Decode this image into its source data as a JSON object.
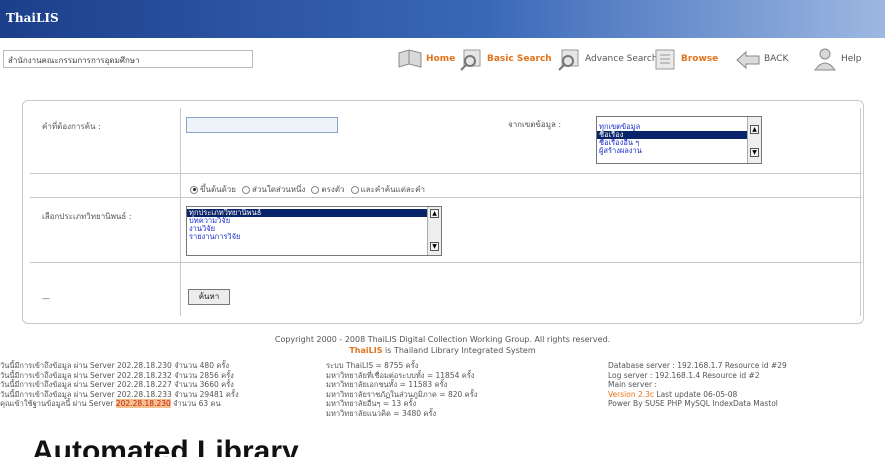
{
  "app": {
    "title": "ThaiLIS"
  },
  "nav": {
    "institution_value": "สำนักงานคณะกรรมการการอุดมศึกษา",
    "items": [
      {
        "label": "Home",
        "icon": "home-book-icon"
      },
      {
        "label": "Basic Search",
        "icon": "magnifier-icon"
      },
      {
        "label": "Advance Search",
        "icon": "magnifier-icon"
      },
      {
        "label": "Browse",
        "icon": "folder-icon"
      },
      {
        "label": "BACK",
        "icon": "back-arrow-icon"
      },
      {
        "label": "Help",
        "icon": "user-help-icon"
      }
    ]
  },
  "form": {
    "keyword_label": "คำที่ต้องการค้น :",
    "keyword_value": "",
    "field_label": "จากเขตข้อมูล :",
    "field_options": [
      "ทุกเขตข้อมูล",
      "ชื่อเรื่อง",
      "ชื่อเรื่องอื่น ๆ",
      "ผู้สร้างผลงาน"
    ],
    "field_selected": "ชื่อเรื่อง",
    "match_options": [
      {
        "label": "ขึ้นต้นด้วย",
        "checked": true
      },
      {
        "label": "ส่วนใดส่วนหนึ่ง",
        "checked": false
      },
      {
        "label": "ตรงตัว",
        "checked": false
      },
      {
        "label": "และคำค้นแต่ละคำ",
        "checked": false
      }
    ],
    "category_label": "เลือกประเภทวิทยานิพนธ์ :",
    "category_options": [
      "ทุกประเภทวิทยานิพนธ์",
      "บทความวิจัย",
      "งานวิจัย",
      "รายงานการวิจัย"
    ],
    "category_selected": "ทุกประเภทวิทยานิพนธ์",
    "bottom_label": "—",
    "search_button": "ค้นหา"
  },
  "footer": {
    "copyright": "Copyright 2000 - 2008 ThaiLIS Digital Collection Working Group. All rights reserved.",
    "tagline_brand": "ThaiLIS",
    "tagline_rest": "is Thailand Library Integrated System",
    "stats_left": [
      "วันนี้มีการเข้าถึงข้อมูล ผ่าน Server 202.28.18.230 จำนวน 480 ครั้ง",
      "วันนี้มีการเข้าถึงข้อมูล ผ่าน Server 202.28.18.232 จำนวน 2856 ครั้ง",
      "วันนี้มีการเข้าถึงข้อมูล ผ่าน Server 202.28.18.227 จำนวน 3660 ครั้ง",
      "วันนี้มีการเข้าถึงข้อมูล ผ่าน Server 202.28.18.233 จำนวน 29481 ครั้ง"
    ],
    "stats_left_last_prefix": "คุณเข้าใช้ฐานข้อมูลนี้ ผ่าน Server",
    "stats_left_last_ip": "202.28.18.230",
    "stats_left_last_suffix": "จำนวน 63 คน",
    "stats_mid": [
      "ระบบ ThaiLIS = 8755 ครั้ง",
      "มหาวิทยาลัยที่เชื่อมต่อระบบทั้ง = 11854 ครั้ง",
      "มหาวิทยาลัยเอกชนทั้ง = 11583 ครั้ง",
      "มหาวิทยาลัยราชภัฏในส่วนภูมิภาค = 820 ครั้ง",
      "มหาวิทยาลัยอื่นๆ = 13 ครั้ง",
      "มหาวิทยาลัยแนวคิด = 3480 ครั้ง"
    ],
    "stats_right": [
      "Database server : 192.168.1.7 Resource id #29",
      "Log server : 192.168.1.4 Resource id #2",
      "Main server :"
    ],
    "version_label": "Version 2.3c",
    "version_rest": "Last update 06-05-08",
    "powered": "Power By SUSE PHP MySQL IndexData Mastol"
  },
  "caption": "Automated Library"
}
